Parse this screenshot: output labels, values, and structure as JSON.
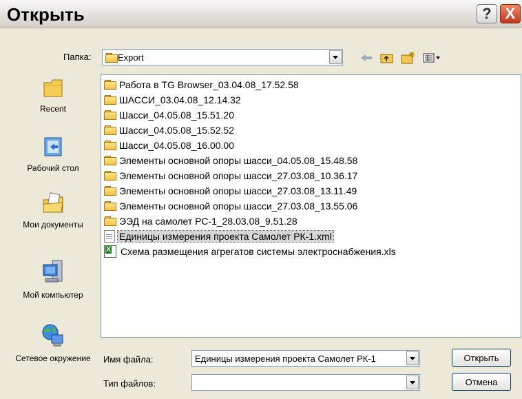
{
  "window": {
    "title": "Открыть",
    "help_label": "?",
    "close_label": "X"
  },
  "location": {
    "label": "Папка:",
    "value": "Export"
  },
  "toolbar": {
    "back_icon": "back-arrow-icon",
    "up_icon": "up-folder-icon",
    "new_folder_icon": "new-folder-icon",
    "views_icon": "views-menu-icon"
  },
  "places": [
    {
      "label": "Recent",
      "icon": "recent-folder-icon"
    },
    {
      "label": "Рабочий стол",
      "icon": "desktop-icon"
    },
    {
      "label": "Мои документы",
      "icon": "my-documents-icon"
    },
    {
      "label": "Мой компьютер",
      "icon": "my-computer-icon"
    },
    {
      "label": "Сетевое окружение",
      "icon": "network-icon"
    }
  ],
  "files": [
    {
      "name": "Работа в TG Browser_03.04.08_17.52.58",
      "type": "folder"
    },
    {
      "name": "ШАССИ_03.04.08_12.14.32",
      "type": "folder"
    },
    {
      "name": "Шасси_04.05.08_15.51.20",
      "type": "folder"
    },
    {
      "name": "Шасси_04.05.08_15.52.52",
      "type": "folder"
    },
    {
      "name": "Шасси_04.05.08_16.00.00",
      "type": "folder"
    },
    {
      "name": "Элементы основной опоры шасси_04.05.08_15.48.58",
      "type": "folder"
    },
    {
      "name": "Элементы основной опоры шасси_27.03.08_10.36.17",
      "type": "folder"
    },
    {
      "name": "Элементы основной опоры шасси_27.03.08_13.11.49",
      "type": "folder"
    },
    {
      "name": "Элементы основной опоры шасси_27.03.08_13.55.06",
      "type": "folder"
    },
    {
      "name": "ЭЭД на самолет РС-1_28.03.08_9.51.28",
      "type": "folder"
    },
    {
      "name": "Единицы измерения проекта Самолет РК-1.xml",
      "type": "xml",
      "selected": true
    },
    {
      "name": "Схема размещения агрегатов системы электроснабжения.xls",
      "type": "xls"
    }
  ],
  "filename": {
    "label": "Имя файла:",
    "value": "Единицы измерения проекта Самолет РК-1"
  },
  "filetype": {
    "label": "Тип файлов:",
    "value": ""
  },
  "buttons": {
    "open": "Открыть",
    "cancel": "Отмена"
  }
}
